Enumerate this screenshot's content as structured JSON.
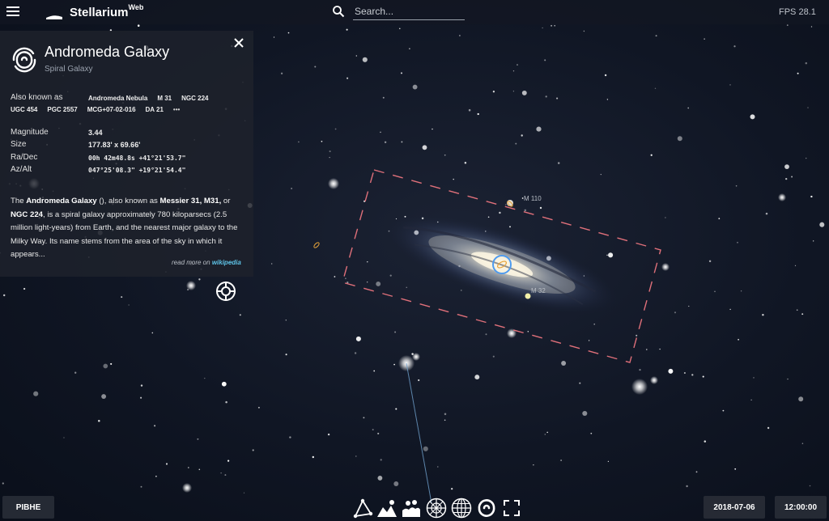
{
  "app": {
    "title": "Stellarium",
    "title_suffix": "Web",
    "fps": "FPS 28.1"
  },
  "search": {
    "placeholder": "Search..."
  },
  "object": {
    "name": "Andromeda Galaxy",
    "type": "Spiral Galaxy",
    "also_known_as_label": "Also known as",
    "aliases_row1": [
      "Andromeda Nebula",
      "M 31",
      "NGC 224"
    ],
    "aliases_row2": [
      "UGC 454",
      "PGC 2557",
      "MCG+07-02-016",
      "DA 21"
    ],
    "aliases_more": "•••",
    "attributes": [
      {
        "label": "Magnitude",
        "value": "3.44"
      },
      {
        "label": "Size",
        "value": "177.83' x 69.66'"
      },
      {
        "label": "Ra/Dec",
        "value": "00h 42m48.8s  +41°21'53.7\""
      },
      {
        "label": "Az/Alt",
        "value": "047°25'08.3\"  +19°21'54.4\""
      }
    ],
    "description": {
      "t1": "The ",
      "b1": "Andromeda Galaxy",
      "t2": " (), also known as ",
      "b2": "Messier 31, M31,",
      "t3": " or ",
      "b3": "NGC 224",
      "t4": ", is a spiral galaxy approximately 780 kiloparsecs (2.5 million light-years) from Earth, and the nearest major galaxy to the Milky Way. Its name stems from the area of the sky in which it appears..."
    },
    "read_more_prefix": "read more on ",
    "read_more_link": "wikipedia"
  },
  "sky_labels": {
    "m110": "M 110",
    "m32": "M 32"
  },
  "bottom": {
    "location": "PIBHE",
    "date": "2018-07-06",
    "time": "12:00:00"
  },
  "toolbar": [
    "constellation-lines-icon",
    "landscape-icon",
    "atmosphere-icon",
    "azimuthal-grid-icon",
    "equatorial-grid-icon",
    "deep-sky-objects-icon",
    "fullscreen-icon"
  ],
  "colors": {
    "selection_ring": "#4f9bef",
    "frame_dash": "#e0707a",
    "link": "#5fc4e8"
  }
}
